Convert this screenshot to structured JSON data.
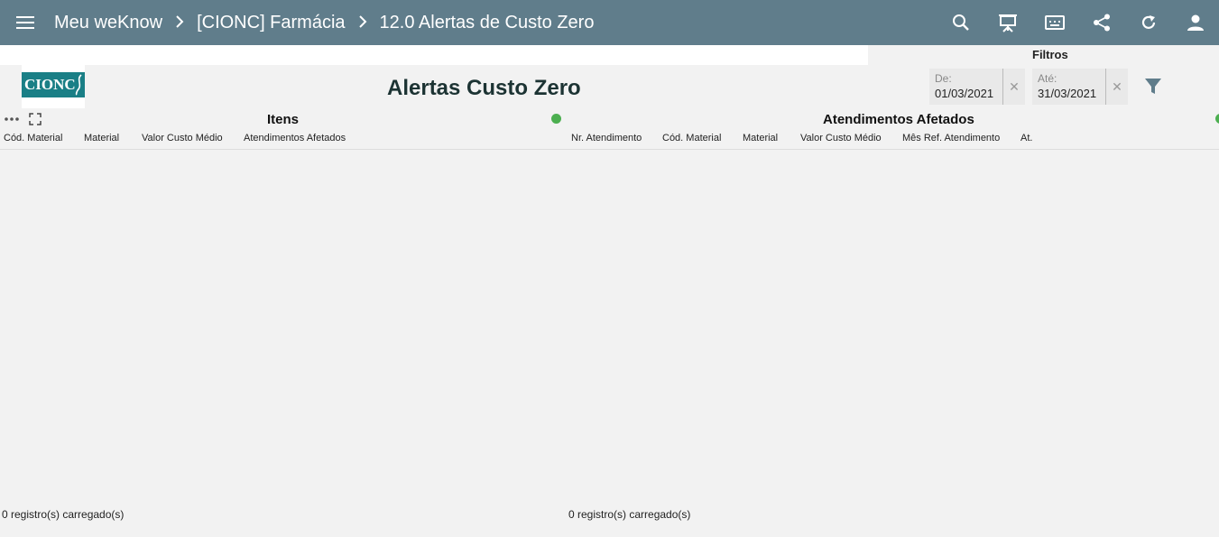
{
  "topbar": {
    "breadcrumbs": [
      "Meu weKnow",
      "[CIONC] Farmácia",
      "12.0 Alertas de Custo Zero"
    ],
    "actions": [
      "search-icon",
      "presentation-icon",
      "keyboard-icon",
      "share-icon",
      "refresh-icon",
      "user-icon"
    ]
  },
  "logo": {
    "text": "CIONC"
  },
  "page": {
    "title": "Alertas Custo Zero"
  },
  "filters": {
    "title": "Filtros",
    "from": {
      "label": "De:",
      "value": "01/03/2021"
    },
    "to": {
      "label": "Até:",
      "value": "31/03/2021"
    }
  },
  "panels": {
    "itens": {
      "title": "Itens",
      "status_color": "#4caf50",
      "columns": [
        "Cód. Material",
        "Material",
        "Valor Custo Médio",
        "Atendimentos Afetados"
      ],
      "footer": "0 registro(s) carregado(s)"
    },
    "atendimentos": {
      "title": "Atendimentos Afetados",
      "status_color": "#4caf50",
      "columns": [
        "Nr. Atendimento",
        "Cód. Material",
        "Material",
        "Valor Custo Médio",
        "Mês Ref. Atendimento",
        "At."
      ],
      "footer": "0 registro(s) carregado(s)"
    }
  },
  "colors": {
    "topbar": "#607d8b",
    "accent": "#4caf50",
    "logo_bg": "#1a7f86"
  }
}
